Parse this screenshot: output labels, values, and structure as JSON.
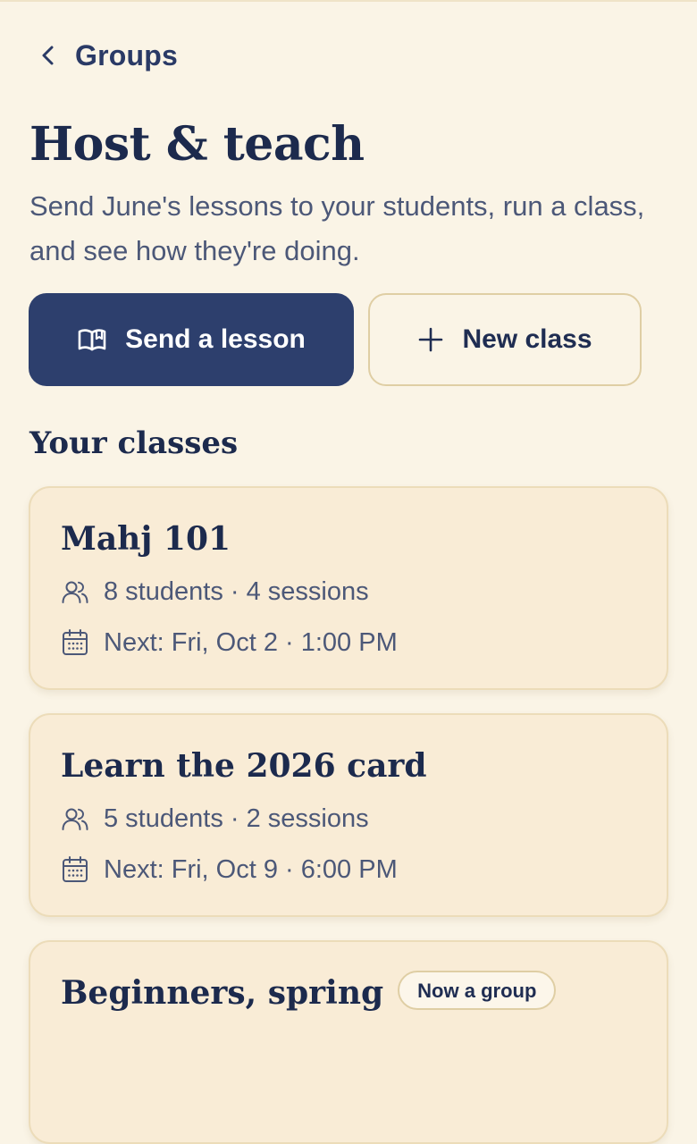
{
  "header": {
    "back_label": "Groups",
    "title": "Host & teach",
    "description": "Send June's lessons to your students, run a class, and see how they're doing."
  },
  "actions": {
    "send_lesson_label": "Send a lesson",
    "new_class_label": "New class"
  },
  "classes_section": {
    "title": "Your classes",
    "classes": [
      {
        "name": "Mahj 101",
        "students": "8 students · 4 sessions",
        "next": "Next: Fri, Oct 2 · 1:00 PM"
      },
      {
        "name": "Learn the 2026 card",
        "students": "5 students · 2 sessions",
        "next": "Next: Fri, Oct 9 · 6:00 PM"
      },
      {
        "name": "Beginners, spring",
        "badge": "Now a group"
      }
    ]
  },
  "icons": {
    "back": "chevron-left-icon",
    "send_lesson": "book-icon",
    "new_class": "plus-icon",
    "students": "users-icon",
    "next": "calendar-icon"
  },
  "colors": {
    "background": "#faf4e6",
    "primary": "#2d3f6d",
    "card": "#f9ecd6",
    "card_border": "#ecdcb9",
    "text_dark": "#1c2a4d",
    "text_muted": "#4c5878"
  }
}
